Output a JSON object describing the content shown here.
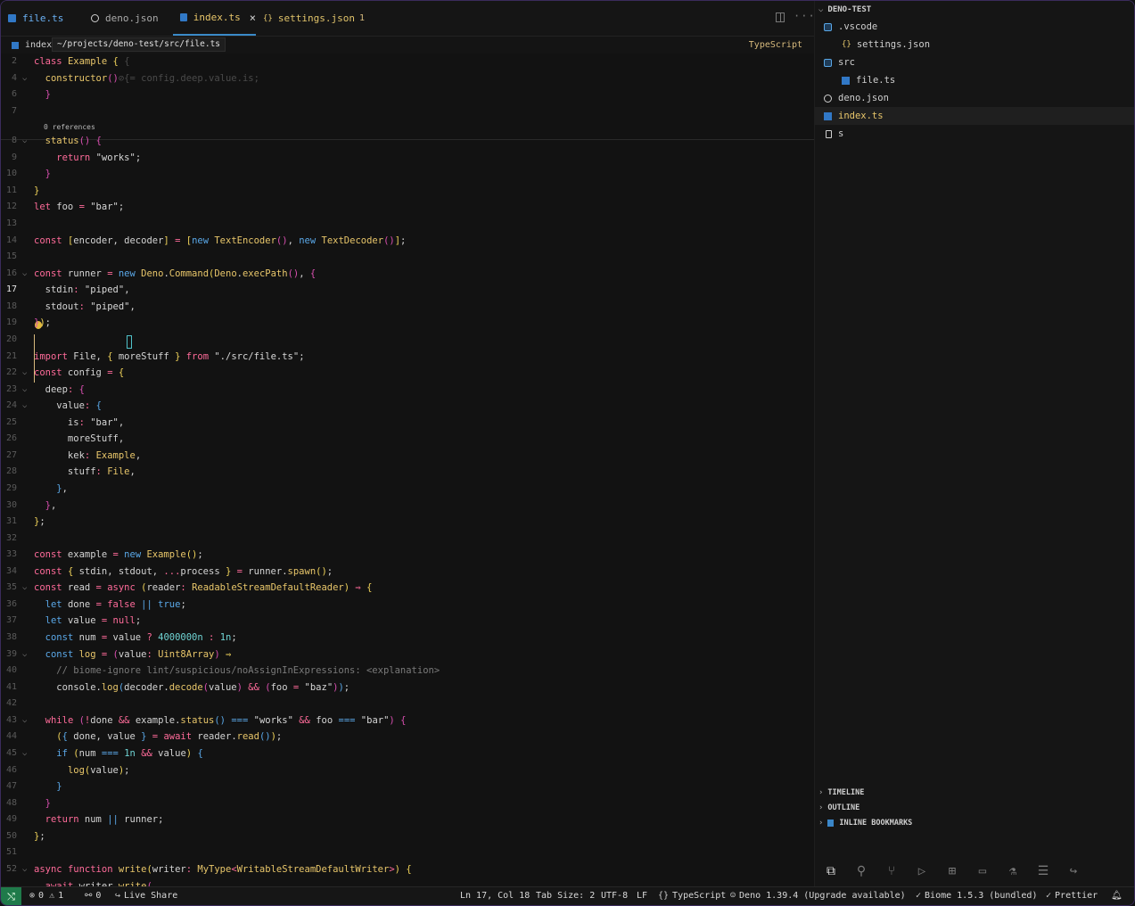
{
  "tabs": [
    {
      "label": "file.ts"
    },
    {
      "label": "deno.json"
    },
    {
      "label": "index.ts",
      "close": "×"
    },
    {
      "label": "settings.json",
      "badge": "1",
      "icon": "{}"
    }
  ],
  "breadcrumb": {
    "file": "index",
    "tooltip": "~/projects/deno-test/src/file.ts",
    "language": "TypeScript"
  },
  "editor": {
    "sticky_hint": "config.deep.value.is;",
    "codelens": "0 references",
    "lines": [
      {
        "n": "2"
      },
      {
        "n": "4"
      },
      {
        "n": "6"
      },
      {
        "n": "7"
      },
      {
        "n": "8"
      },
      {
        "n": "9"
      },
      {
        "n": "10"
      },
      {
        "n": "11"
      },
      {
        "n": "12"
      },
      {
        "n": "13"
      },
      {
        "n": "14"
      },
      {
        "n": "15"
      },
      {
        "n": "16"
      },
      {
        "n": "17"
      },
      {
        "n": "18"
      },
      {
        "n": "19"
      },
      {
        "n": "20"
      },
      {
        "n": "21"
      },
      {
        "n": "22"
      },
      {
        "n": "23"
      },
      {
        "n": "24"
      },
      {
        "n": "25"
      },
      {
        "n": "26"
      },
      {
        "n": "27"
      },
      {
        "n": "28"
      },
      {
        "n": "29"
      },
      {
        "n": "30"
      },
      {
        "n": "31"
      },
      {
        "n": "32"
      },
      {
        "n": "33"
      },
      {
        "n": "34"
      },
      {
        "n": "35"
      },
      {
        "n": "36"
      },
      {
        "n": "37"
      },
      {
        "n": "38"
      },
      {
        "n": "39"
      },
      {
        "n": "40"
      },
      {
        "n": "41"
      },
      {
        "n": "42"
      },
      {
        "n": "43"
      },
      {
        "n": "44"
      },
      {
        "n": "45"
      },
      {
        "n": "46"
      },
      {
        "n": "47"
      },
      {
        "n": "48"
      },
      {
        "n": "49"
      },
      {
        "n": "50"
      },
      {
        "n": "51"
      },
      {
        "n": "52"
      }
    ]
  },
  "explorer": {
    "title": "DENO-TEST",
    "items": [
      {
        "label": ".vscode"
      },
      {
        "label": "settings.json",
        "icon": "{}"
      },
      {
        "label": "src"
      },
      {
        "label": "file.ts"
      },
      {
        "label": "deno.json"
      },
      {
        "label": "index.ts"
      },
      {
        "label": "s"
      }
    ]
  },
  "panels": {
    "timeline": "TIMELINE",
    "outline": "OUTLINE",
    "bookmarks": "INLINE BOOKMARKS"
  },
  "status": {
    "errors": "0",
    "warnings": "1",
    "ports": "0",
    "live_share": "Live Share",
    "position": "Ln 17, Col 18",
    "tab_size": "Tab Size: 2",
    "encoding": "UTF-8",
    "eol": "LF",
    "language": "TypeScript",
    "deno": "Deno 1.39.4 (Upgrade available)",
    "biome": "Biome 1.5.3 (bundled)",
    "prettier": "Prettier"
  },
  "colors": {
    "accent": "#3a8ac8",
    "remote": "#1f7a4a",
    "keyword": "#ff6b9a",
    "function": "#e8c66a"
  }
}
